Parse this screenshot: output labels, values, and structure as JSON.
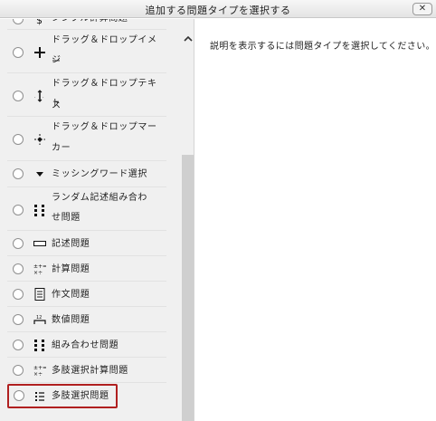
{
  "dialog": {
    "title": "追加する問題タイプを選択する",
    "close_label": "✕"
  },
  "question_types": [
    {
      "label": "シンプル計算問題",
      "icon": "calculated-simple-icon",
      "selected": false
    },
    {
      "label": "ドラッグ＆ドロップイメージ",
      "line1": "ドラッグ＆ドロップイメー",
      "line2": "ジ",
      "icon": "drag-drop-image-icon",
      "selected": false
    },
    {
      "label": "ドラッグ＆ドロップテキスト",
      "line1": "ドラッグ＆ドロップテキス",
      "line2": "ト",
      "icon": "drag-drop-text-icon",
      "selected": false
    },
    {
      "label": "ドラッグ＆ドロップマーカー",
      "line1": "ドラッグ＆ドロップマー",
      "line2": "カー",
      "icon": "drag-drop-marker-icon",
      "selected": false
    },
    {
      "label": "ミッシングワード選択",
      "icon": "missing-word-icon",
      "selected": false
    },
    {
      "label": "ランダム記述組み合わせ問題",
      "line1": "ランダム記述組み合わ",
      "line2": "せ問題",
      "icon": "random-matching-icon",
      "selected": false
    },
    {
      "label": "記述問題",
      "icon": "short-answer-icon",
      "selected": false
    },
    {
      "label": "計算問題",
      "icon": "calculated-icon",
      "selected": false
    },
    {
      "label": "作文問題",
      "icon": "essay-icon",
      "selected": false
    },
    {
      "label": "数値問題",
      "icon": "numerical-icon",
      "selected": false
    },
    {
      "label": "組み合わせ問題",
      "icon": "matching-icon",
      "selected": false
    },
    {
      "label": "多肢選択計算問題",
      "icon": "calculated-multichoice-icon",
      "selected": false
    },
    {
      "label": "多肢選択問題",
      "icon": "multichoice-icon",
      "selected": false,
      "highlighted": true
    }
  ],
  "description": {
    "text": "説明を表示するには問題タイプを選択してください。"
  },
  "scrollbar": {
    "up_arrow": "chevron-up-icon"
  }
}
